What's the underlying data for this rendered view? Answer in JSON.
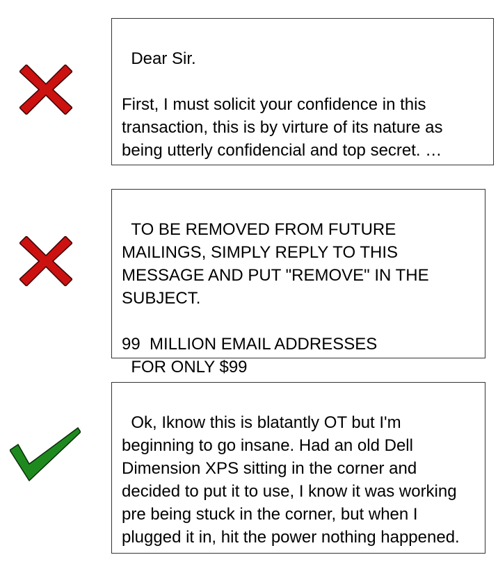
{
  "items": [
    {
      "verdict": "rejected",
      "icon": "x-mark-icon",
      "icon_color": "#cc1111",
      "text": "Dear Sir.\n\nFirst, I must solicit your confidence in this transaction, this is by virture of its nature as being utterly confidencial and top secret. …"
    },
    {
      "verdict": "rejected",
      "icon": "x-mark-icon",
      "icon_color": "#cc1111",
      "text": "TO BE REMOVED FROM FUTURE MAILINGS, SIMPLY REPLY TO THIS MESSAGE AND PUT \"REMOVE\" IN THE SUBJECT.\n\n99  MILLION EMAIL ADDRESSES\n  FOR ONLY $99"
    },
    {
      "verdict": "accepted",
      "icon": "check-mark-icon",
      "icon_color": "#1e8a1e",
      "text": "Ok, Iknow this is blatantly OT but I'm beginning to go insane. Had an old Dell Dimension XPS sitting in the corner and decided to put it to use, I know it was working pre being stuck in the corner, but when I plugged it in, hit the power nothing happened."
    }
  ]
}
